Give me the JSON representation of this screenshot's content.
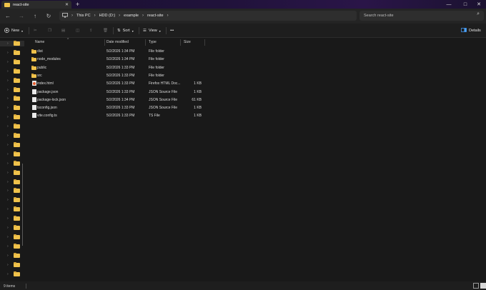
{
  "tab": {
    "title": "react-site",
    "close": "✕"
  },
  "new_tab": "+",
  "window": {
    "minimize": "—",
    "maximize": "□",
    "close": "✕"
  },
  "nav": {
    "back": "←",
    "forward": "→",
    "up": "↑",
    "refresh": "↻"
  },
  "breadcrumb": [
    "This PC",
    "HDD (D:)",
    "example",
    "react-site"
  ],
  "search": {
    "placeholder": "Search react-site"
  },
  "toolbar": {
    "new_label": "New",
    "sort_label": "Sort",
    "view_label": "View",
    "more_label": "•••",
    "details_label": "Details"
  },
  "columns": {
    "name": "Name",
    "date": "Date modified",
    "type": "Type",
    "size": "Size"
  },
  "files": [
    {
      "name": "dist",
      "date": "5/2/2026 1:34 PM",
      "type": "File folder",
      "size": "",
      "icon": "folder-icon"
    },
    {
      "name": "node_modules",
      "date": "5/2/2026 1:34 PM",
      "type": "File folder",
      "size": "",
      "icon": "folder-icon"
    },
    {
      "name": "public",
      "date": "5/2/2026 1:33 PM",
      "type": "File folder",
      "size": "",
      "icon": "folder-icon"
    },
    {
      "name": "src",
      "date": "5/2/2026 1:33 PM",
      "type": "File folder",
      "size": "",
      "icon": "folder-icon"
    },
    {
      "name": "index.html",
      "date": "5/2/2026 1:33 PM",
      "type": "Firefox HTML Doc...",
      "size": "1 KB",
      "icon": "html-file-icon"
    },
    {
      "name": "package.json",
      "date": "5/2/2026 1:33 PM",
      "type": "JSON Source File",
      "size": "1 KB",
      "icon": "file-icon"
    },
    {
      "name": "package-lock.json",
      "date": "5/2/2026 1:34 PM",
      "type": "JSON Source File",
      "size": "61 KB",
      "icon": "file-icon"
    },
    {
      "name": "tsconfig.json",
      "date": "5/2/2026 1:33 PM",
      "type": "JSON Source File",
      "size": "1 KB",
      "icon": "file-icon"
    },
    {
      "name": "vite.config.ts",
      "date": "5/2/2026 1:33 PM",
      "type": "TS File",
      "size": "1 KB",
      "icon": "file-icon"
    }
  ],
  "status": {
    "count": "9 items"
  },
  "colors": {
    "folder": "#f0c24b",
    "accent": "#4aa3ff",
    "background": "#191919"
  }
}
